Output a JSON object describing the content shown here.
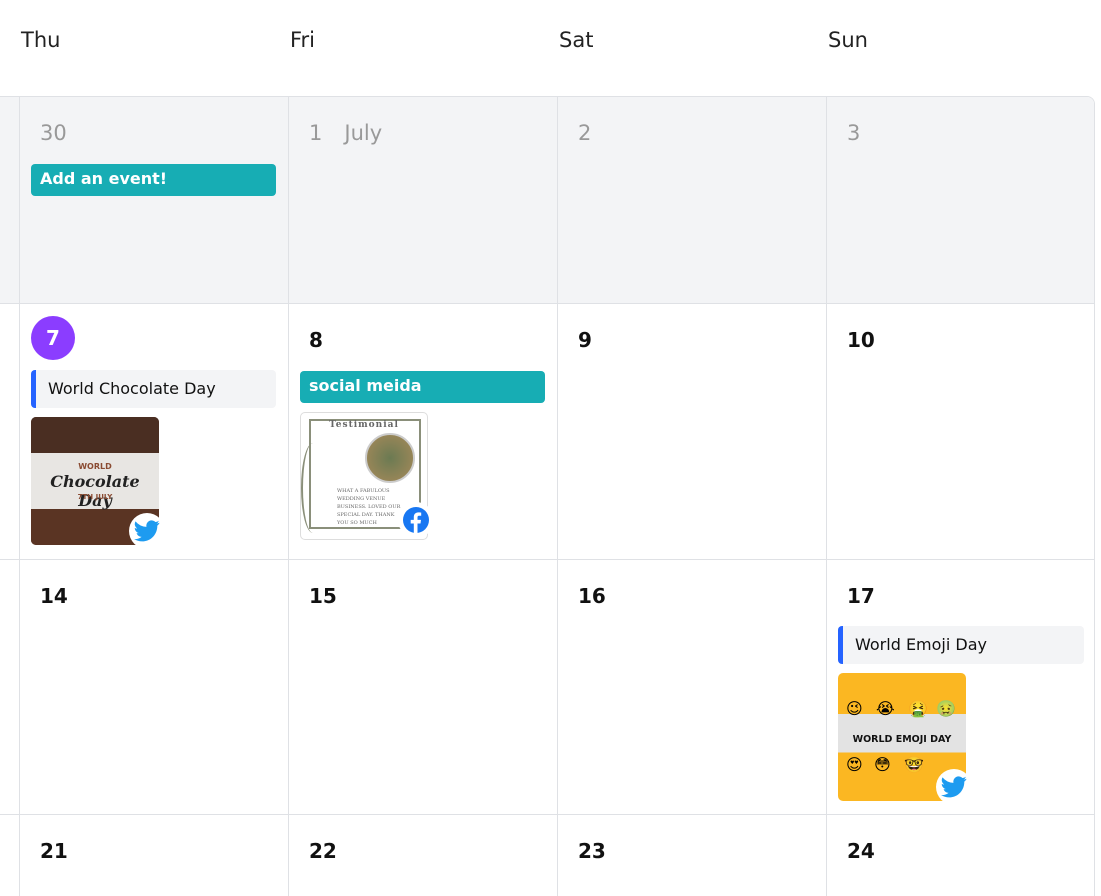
{
  "header": {
    "days": [
      "Thu",
      "Fri",
      "Sat",
      "Sun"
    ]
  },
  "weeks": [
    {
      "days": [
        {
          "num": "30",
          "events": [
            {
              "type": "note",
              "label": "Add an event!"
            }
          ]
        },
        {
          "num": "1",
          "month": "July"
        },
        {
          "num": "2"
        },
        {
          "num": "3"
        }
      ]
    },
    {
      "days": [
        {
          "num": "7",
          "today": true,
          "events": [
            {
              "type": "event",
              "label": "World Chocolate Day"
            },
            {
              "type": "post",
              "network": "twitter",
              "image_text": [
                "WORLD",
                "Chocolate Day",
                "7TH JULY"
              ]
            }
          ]
        },
        {
          "num": "8",
          "events": [
            {
              "type": "note",
              "label": "social meida"
            },
            {
              "type": "post",
              "network": "facebook",
              "image_text": [
                "Testimonial",
                "WHAT A FABULOUS WEDDING VENUE BUSINESS. LOVED OUR SPECIAL DAY. THANK YOU SO MUCH"
              ]
            }
          ]
        },
        {
          "num": "9"
        },
        {
          "num": "10"
        }
      ]
    },
    {
      "days": [
        {
          "num": "14"
        },
        {
          "num": "15"
        },
        {
          "num": "16"
        },
        {
          "num": "17",
          "events": [
            {
              "type": "event",
              "label": "World Emoji Day"
            },
            {
              "type": "post",
              "network": "twitter",
              "image_text": [
                "WORLD EMOJI DAY"
              ]
            }
          ]
        }
      ]
    },
    {
      "days": [
        {
          "num": "21"
        },
        {
          "num": "22"
        },
        {
          "num": "23"
        },
        {
          "num": "24"
        }
      ]
    }
  ],
  "colors": {
    "today": "#8b3dff",
    "note": "#17adb4",
    "event_bar": "#2563ff",
    "past_bg": "#f3f4f6",
    "twitter": "#1d9bf0",
    "facebook": "#1877f2"
  },
  "icons": {
    "twitter": "twitter-bird-icon",
    "facebook": "facebook-f-icon"
  }
}
